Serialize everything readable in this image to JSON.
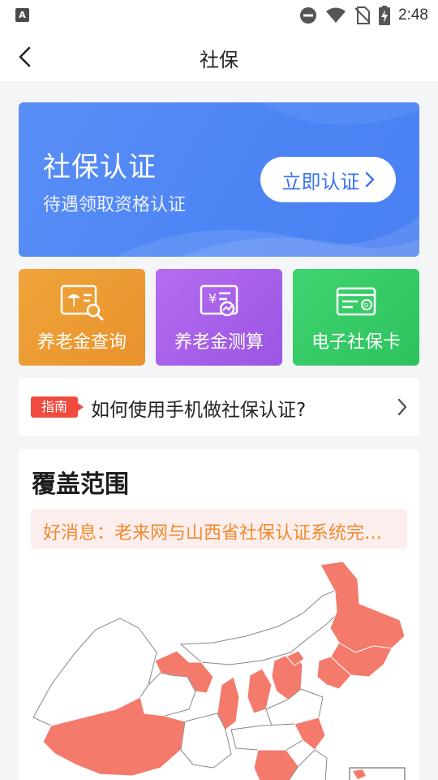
{
  "status_bar": {
    "app_badge": "A",
    "time": "2:48",
    "icons": [
      "dnd-icon",
      "wifi-icon",
      "no-sim-icon",
      "battery-charging-icon"
    ]
  },
  "nav": {
    "title": "社保",
    "back_icon": "chevron-left-icon"
  },
  "banner": {
    "title": "社保认证",
    "subtitle": "待遇领取资格认证",
    "button_label": "立即认证",
    "button_icon": "chevron-right-icon"
  },
  "tiles": [
    {
      "label": "养老金查询",
      "icon": "umbrella-search-icon",
      "color": "#eda03a"
    },
    {
      "label": "养老金测算",
      "icon": "yen-chart-icon",
      "color": "#a860eb"
    },
    {
      "label": "电子社保卡",
      "icon": "si-card-icon",
      "color": "#38cc69"
    }
  ],
  "guide": {
    "tag": "指南",
    "text": "如何使用手机做社保认证?"
  },
  "coverage": {
    "title": "覆盖范围",
    "notice": "好消息：老来网与山西省社保认证系统完成对接",
    "map_highlight_color": "#f47a6c"
  }
}
